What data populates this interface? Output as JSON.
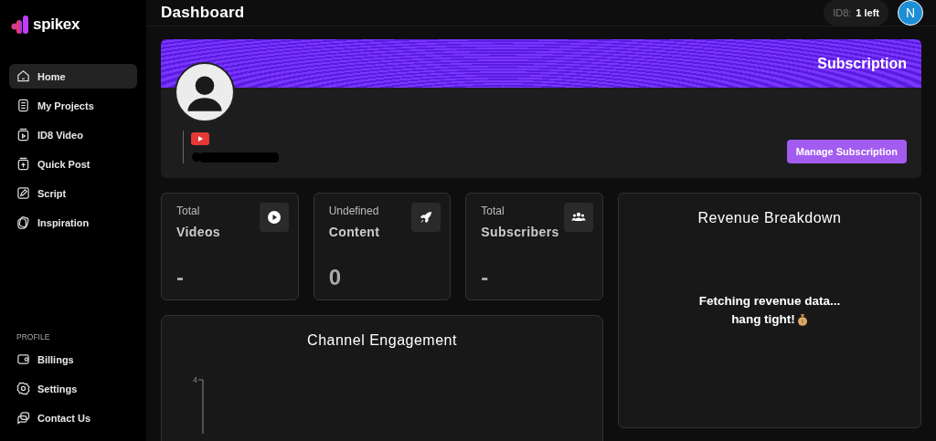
{
  "sidebar": {
    "logo": "spikex",
    "nav": [
      {
        "label": "Home",
        "kind": "home",
        "selected": true
      },
      {
        "label": "My Projects",
        "kind": "projects",
        "selected": false
      },
      {
        "label": "ID8 Video",
        "kind": "video",
        "selected": false
      },
      {
        "label": "Quick Post",
        "kind": "post",
        "selected": false
      },
      {
        "label": "Script",
        "kind": "script",
        "selected": false
      },
      {
        "label": "Inspiration",
        "kind": "inspiration",
        "selected": false
      }
    ],
    "profile_heading": "PROFILE",
    "profile": [
      {
        "label": "Billings",
        "kind": "wallet",
        "selected": false
      },
      {
        "label": "Settings",
        "kind": "settings",
        "selected": false
      },
      {
        "label": "Contact Us",
        "kind": "chat",
        "selected": false
      }
    ]
  },
  "header": {
    "title": "Dashboard",
    "credits_label": "ID8:",
    "credits_value": "1 left",
    "avatar_initial": "N"
  },
  "subscription": {
    "title": "Subscription",
    "button": "Manage Subscription"
  },
  "stats": [
    {
      "label": "Total",
      "title": "Videos",
      "value": "-",
      "kind": "play"
    },
    {
      "label": "Undefined",
      "title": "Content",
      "value": "0",
      "kind": "rocket"
    },
    {
      "label": "Total",
      "title": "Subscribers",
      "value": "-",
      "kind": "users"
    }
  ],
  "engagement": {
    "title": "Channel Engagement",
    "y_tick": "4"
  },
  "revenue": {
    "title": "Revenue Breakdown",
    "message_line1": "Fetching revenue data...",
    "message_line2": "hang tight!"
  }
}
